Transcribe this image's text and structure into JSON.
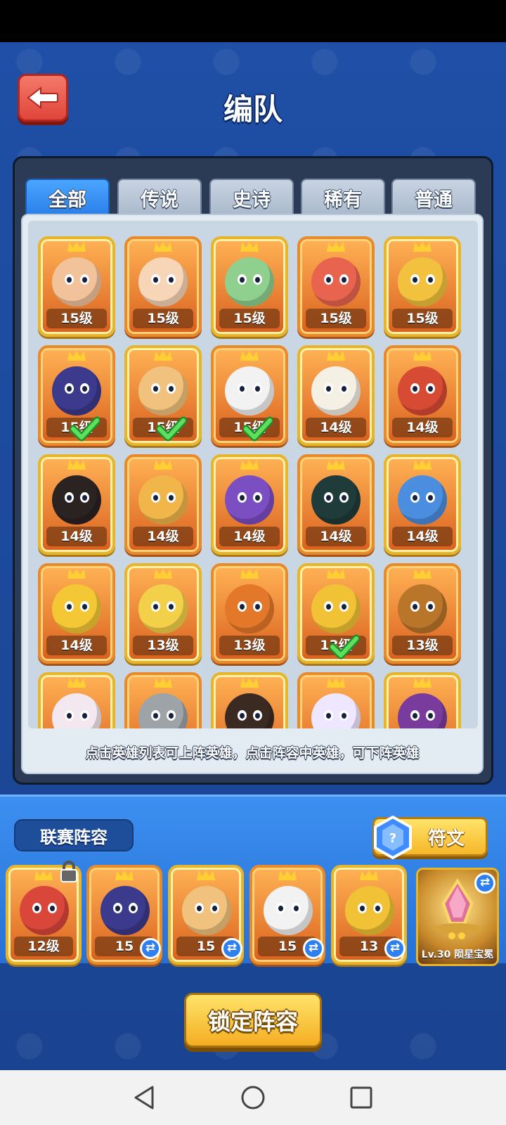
{
  "header": {
    "title": "编队"
  },
  "tabs": [
    "全部",
    "传说",
    "史诗",
    "稀有",
    "普通"
  ],
  "active_tab": 0,
  "heroes": [
    {
      "level": "15级",
      "color": "#f2c39b",
      "selected": false
    },
    {
      "level": "15级",
      "color": "#f7d6b8",
      "selected": false
    },
    {
      "level": "15级",
      "color": "#8fd08f",
      "selected": false
    },
    {
      "level": "15级",
      "color": "#e8644f",
      "selected": false
    },
    {
      "level": "15级",
      "color": "#f2c23f",
      "selected": false
    },
    {
      "level": "15级",
      "color": "#3c3a8c",
      "selected": true
    },
    {
      "level": "15级",
      "color": "#f0c27d",
      "selected": true
    },
    {
      "level": "15级",
      "color": "#f2f2f2",
      "selected": true
    },
    {
      "level": "14级",
      "color": "#f5f0e4",
      "selected": false
    },
    {
      "level": "14级",
      "color": "#d74a33",
      "selected": false
    },
    {
      "level": "14级",
      "color": "#2b2222",
      "selected": false
    },
    {
      "level": "14级",
      "color": "#f0b64a",
      "selected": false
    },
    {
      "level": "14级",
      "color": "#7b4ec2",
      "selected": false
    },
    {
      "level": "14级",
      "color": "#1f3b3a",
      "selected": false
    },
    {
      "level": "14级",
      "color": "#4b8ee0",
      "selected": false
    },
    {
      "level": "14级",
      "color": "#f4c735",
      "selected": false
    },
    {
      "level": "13级",
      "color": "#f2d04a",
      "selected": false
    },
    {
      "level": "13级",
      "color": "#e3782a",
      "selected": false
    },
    {
      "level": "13级",
      "color": "#f1c235",
      "selected": true
    },
    {
      "level": "13级",
      "color": "#b9762a",
      "selected": false
    },
    {
      "level": "",
      "color": "#f3e7f0",
      "selected": false
    },
    {
      "level": "",
      "color": "#9ea3a8",
      "selected": false
    },
    {
      "level": "",
      "color": "#3b2a22",
      "selected": false
    },
    {
      "level": "",
      "color": "#efe7ff",
      "selected": false
    },
    {
      "level": "",
      "color": "#7a3c9c",
      "selected": false
    }
  ],
  "hint": "点击英雄列表可上阵英雄，点击阵容中英雄，可下阵英雄",
  "lineup": {
    "label": "联赛阵容",
    "rune_label": "符文",
    "slots": [
      {
        "level": "12级",
        "color": "#d9463a",
        "locked": true
      },
      {
        "level": "15",
        "color": "#3c3a8c",
        "locked": false
      },
      {
        "level": "15",
        "color": "#f0c27d",
        "locked": false
      },
      {
        "level": "15",
        "color": "#f2f2f2",
        "locked": false
      },
      {
        "level": "13",
        "color": "#f1c235",
        "locked": false
      }
    ],
    "treasure_label": "Lv.30 陨星宝冕"
  },
  "lock_button": "锁定阵容"
}
